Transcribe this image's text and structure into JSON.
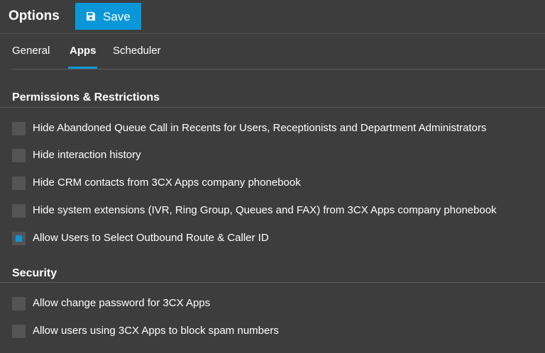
{
  "header": {
    "title": "Options",
    "save_label": "Save",
    "save_icon": "floppy-disk-icon"
  },
  "tabs": [
    {
      "label": "General",
      "active": false
    },
    {
      "label": "Apps",
      "active": true
    },
    {
      "label": "Scheduler",
      "active": false
    }
  ],
  "sections": {
    "permissions": {
      "title": "Permissions & Restrictions",
      "options": [
        {
          "label": "Hide Abandoned Queue Call in Recents for Users, Receptionists and Department Administrators",
          "checked": false
        },
        {
          "label": "Hide interaction history",
          "checked": false
        },
        {
          "label": "Hide CRM contacts from 3CX Apps company phonebook",
          "checked": false
        },
        {
          "label": "Hide system extensions (IVR, Ring Group, Queues and FAX) from 3CX Apps company phonebook",
          "checked": false
        },
        {
          "label": "Allow Users to Select Outbound Route & Caller ID",
          "checked": true
        }
      ]
    },
    "security": {
      "title": "Security",
      "options": [
        {
          "label": "Allow change password for 3CX Apps",
          "checked": false
        },
        {
          "label": "Allow users using 3CX Apps to block spam numbers",
          "checked": false
        }
      ]
    }
  },
  "colors": {
    "background": "#3d3d3d",
    "accent": "#0a97d9",
    "checkbox": "#545454",
    "divider": "#5a5a5a"
  }
}
